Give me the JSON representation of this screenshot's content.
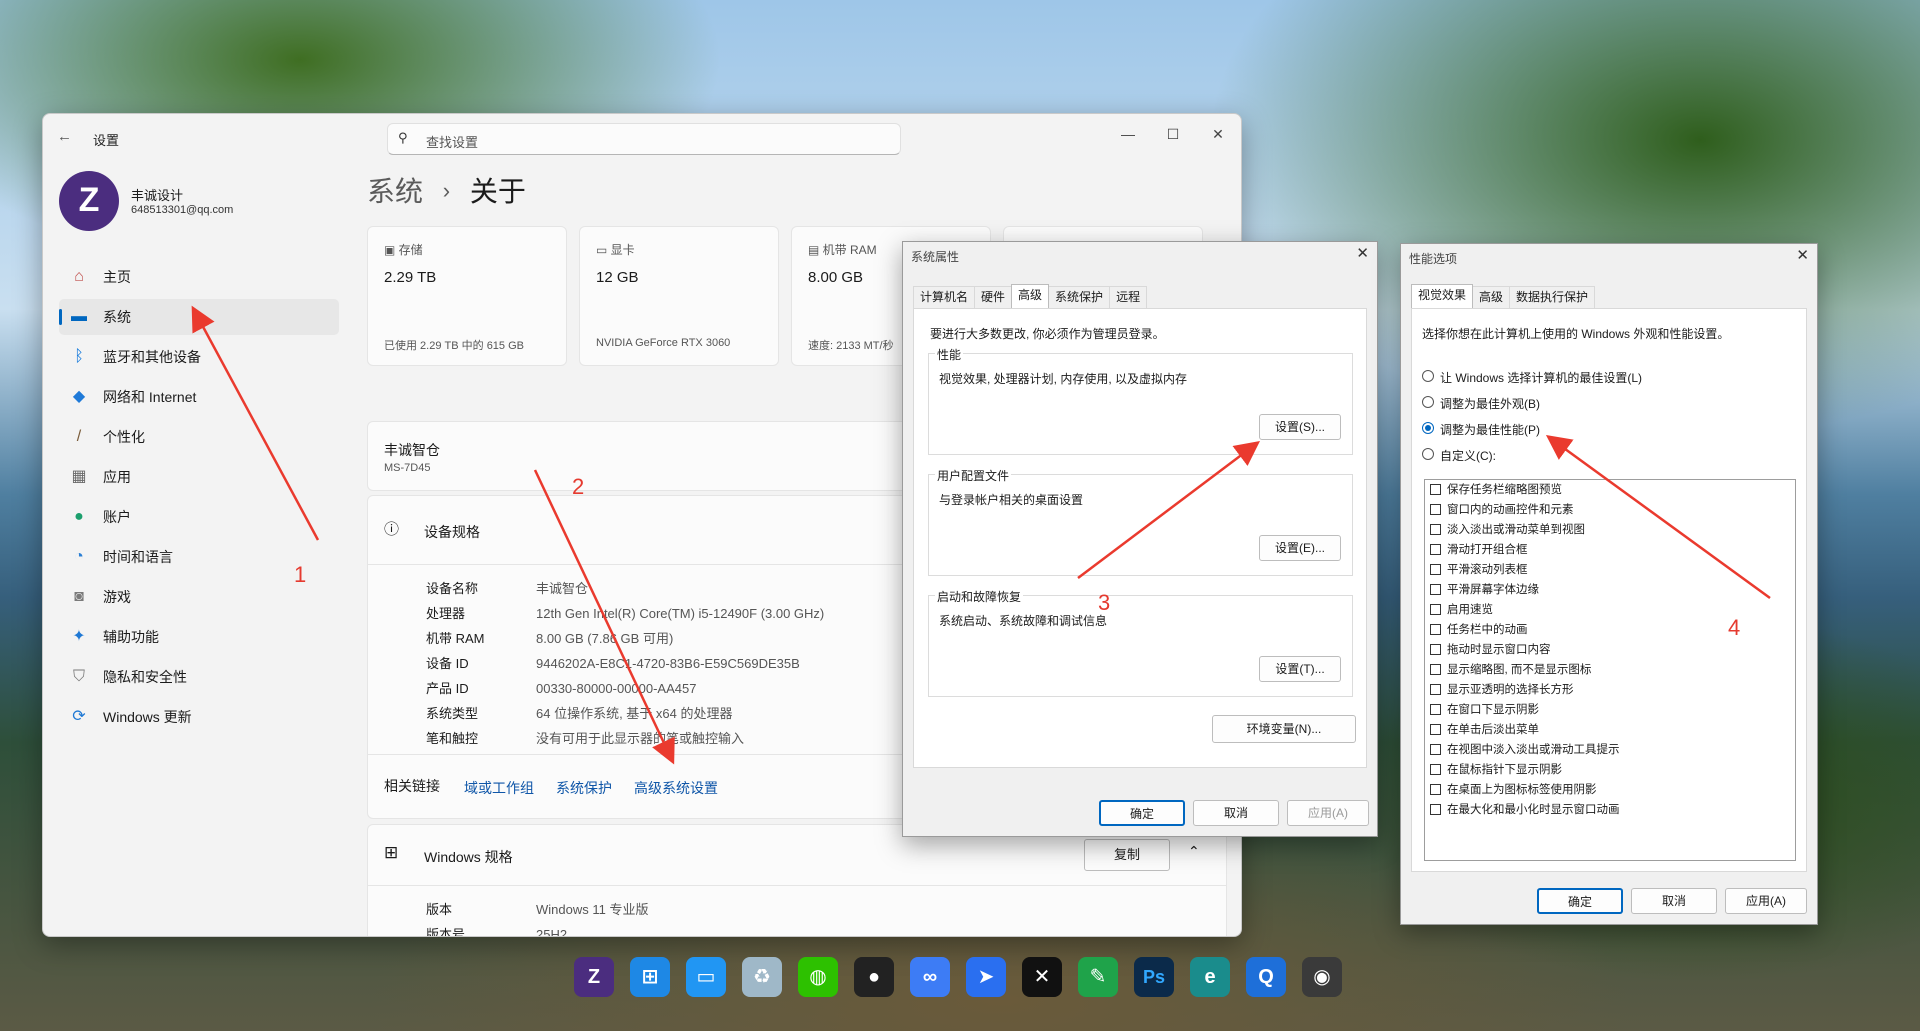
{
  "settings": {
    "title": "设置",
    "search_placeholder": "查找设置",
    "profile": {
      "name": "丰诚设计",
      "email": "648513301@qq.com",
      "avatar_letter": "Z"
    },
    "nav": [
      {
        "label": "主页",
        "icon": "home-icon",
        "glyph": "⌂"
      },
      {
        "label": "系统",
        "icon": "monitor-icon",
        "glyph": "▬"
      },
      {
        "label": "蓝牙和其他设备",
        "icon": "bluetooth-icon",
        "glyph": "ᛒ"
      },
      {
        "label": "网络和 Internet",
        "icon": "wifi-icon",
        "glyph": "◆"
      },
      {
        "label": "个性化",
        "icon": "brush-icon",
        "glyph": "/"
      },
      {
        "label": "应用",
        "icon": "apps-icon",
        "glyph": "▦"
      },
      {
        "label": "账户",
        "icon": "account-icon",
        "glyph": "●"
      },
      {
        "label": "时间和语言",
        "icon": "globe-clock-icon",
        "glyph": "◔"
      },
      {
        "label": "游戏",
        "icon": "gamepad-icon",
        "glyph": "◙"
      },
      {
        "label": "辅助功能",
        "icon": "accessibility-icon",
        "glyph": "✦"
      },
      {
        "label": "隐私和安全性",
        "icon": "shield-icon",
        "glyph": "⛉"
      },
      {
        "label": "Windows 更新",
        "icon": "update-icon",
        "glyph": "⟳"
      }
    ],
    "breadcrumb": {
      "parent": "系统",
      "sep": "›",
      "current": "关于"
    },
    "tiles": [
      {
        "label": "存储",
        "value": "2.29 TB",
        "sub": "已使用 2.29 TB 中的 615 GB"
      },
      {
        "label": "显卡",
        "value": "12 GB",
        "sub": "NVIDIA GeForce RTX 3060"
      },
      {
        "label": "机带 RAM",
        "value": "8.00 GB",
        "sub": "速度: 2133 MT/秒"
      }
    ],
    "device": {
      "name": "丰诚智仓",
      "model": "MS-7D45"
    },
    "specs_title": "设备规格",
    "specs": [
      {
        "label": "设备名称",
        "value": "丰诚智仓"
      },
      {
        "label": "处理器",
        "value": "12th Gen Intel(R) Core(TM) i5-12490F (3.00 GHz)"
      },
      {
        "label": "机带 RAM",
        "value": "8.00 GB (7.86 GB 可用)"
      },
      {
        "label": "设备 ID",
        "value": "9446202A-E8C1-4720-83B6-E59C569DE35B"
      },
      {
        "label": "产品 ID",
        "value": "00330-80000-00000-AA457"
      },
      {
        "label": "系统类型",
        "value": "64 位操作系统, 基于 x64 的处理器"
      },
      {
        "label": "笔和触控",
        "value": "没有可用于此显示器的笔或触控输入"
      }
    ],
    "related": {
      "label": "相关链接",
      "links": [
        "域或工作组",
        "系统保护",
        "高级系统设置"
      ]
    },
    "winspec": {
      "title": "Windows 规格",
      "copy": "复制",
      "rows": [
        {
          "label": "版本",
          "value": "Windows 11 专业版"
        },
        {
          "label": "版本号",
          "value": "25H2"
        }
      ]
    }
  },
  "sysprops": {
    "title": "系统属性",
    "tabs": [
      "计算机名",
      "硬件",
      "高级",
      "系统保护",
      "远程"
    ],
    "active_tab": "高级",
    "notice": "要进行大多数更改, 你必须作为管理员登录。",
    "groups": [
      {
        "title": "性能",
        "desc": "视觉效果, 处理器计划, 内存使用, 以及虚拟内存",
        "button": "设置(S)..."
      },
      {
        "title": "用户配置文件",
        "desc": "与登录帐户相关的桌面设置",
        "button": "设置(E)..."
      },
      {
        "title": "启动和故障恢复",
        "desc": "系统启动、系统故障和调试信息",
        "button": "设置(T)..."
      }
    ],
    "env_button": "环境变量(N)...",
    "ok": "确定",
    "cancel": "取消",
    "apply": "应用(A)"
  },
  "perfopts": {
    "title": "性能选项",
    "tabs": [
      "视觉效果",
      "高级",
      "数据执行保护"
    ],
    "active_tab": "视觉效果",
    "intro": "选择你想在此计算机上使用的 Windows 外观和性能设置。",
    "radios": [
      {
        "label": "让 Windows 选择计算机的最佳设置(L)",
        "checked": false
      },
      {
        "label": "调整为最佳外观(B)",
        "checked": false
      },
      {
        "label": "调整为最佳性能(P)",
        "checked": true
      },
      {
        "label": "自定义(C):",
        "checked": false
      }
    ],
    "checkboxes": [
      "保存任务栏缩略图预览",
      "窗口内的动画控件和元素",
      "淡入淡出或滑动菜单到视图",
      "滑动打开组合框",
      "平滑滚动列表框",
      "平滑屏幕字体边缘",
      "启用速览",
      "任务栏中的动画",
      "拖动时显示窗口内容",
      "显示缩略图, 而不是显示图标",
      "显示亚透明的选择长方形",
      "在窗口下显示阴影",
      "在单击后淡出菜单",
      "在视图中淡入淡出或滑动工具提示",
      "在鼠标指针下显示阴影",
      "在桌面上为图标标签使用阴影",
      "在最大化和最小化时显示窗口动画"
    ],
    "ok": "确定",
    "cancel": "取消",
    "apply": "应用(A)"
  },
  "annotations": [
    "1",
    "2",
    "3",
    "4"
  ],
  "taskbar": [
    {
      "name": "fengcheng-app-icon",
      "color": "#4b2d7f",
      "glyph": "Z"
    },
    {
      "name": "windows-start-icon",
      "color": "#1e88e5",
      "glyph": "⊞"
    },
    {
      "name": "this-pc-icon",
      "color": "#2196f3",
      "glyph": "▭"
    },
    {
      "name": "recycle-bin-icon",
      "color": "#9fb8c8",
      "glyph": "♻"
    },
    {
      "name": "wechat-icon",
      "color": "#2dc100",
      "glyph": "◍"
    },
    {
      "name": "qq-icon",
      "color": "#222222",
      "glyph": "●"
    },
    {
      "name": "baidu-netdisk-icon",
      "color": "#3d7cf5",
      "glyph": "∞"
    },
    {
      "name": "feishu-icon",
      "color": "#2a6ff0",
      "glyph": "➤"
    },
    {
      "name": "capcut-icon",
      "color": "#111111",
      "glyph": "✕"
    },
    {
      "name": "green-app-icon",
      "color": "#1fa34a",
      "glyph": "✎"
    },
    {
      "name": "photoshop-icon",
      "color": "#0b2a4a",
      "glyph": "Ps"
    },
    {
      "name": "edge-icon",
      "color": "#1a8c8c",
      "glyph": "e"
    },
    {
      "name": "browser-icon",
      "color": "#1e6fd9",
      "glyph": "Q"
    },
    {
      "name": "camera-icon",
      "color": "#3a3a3a",
      "glyph": "◉"
    }
  ]
}
